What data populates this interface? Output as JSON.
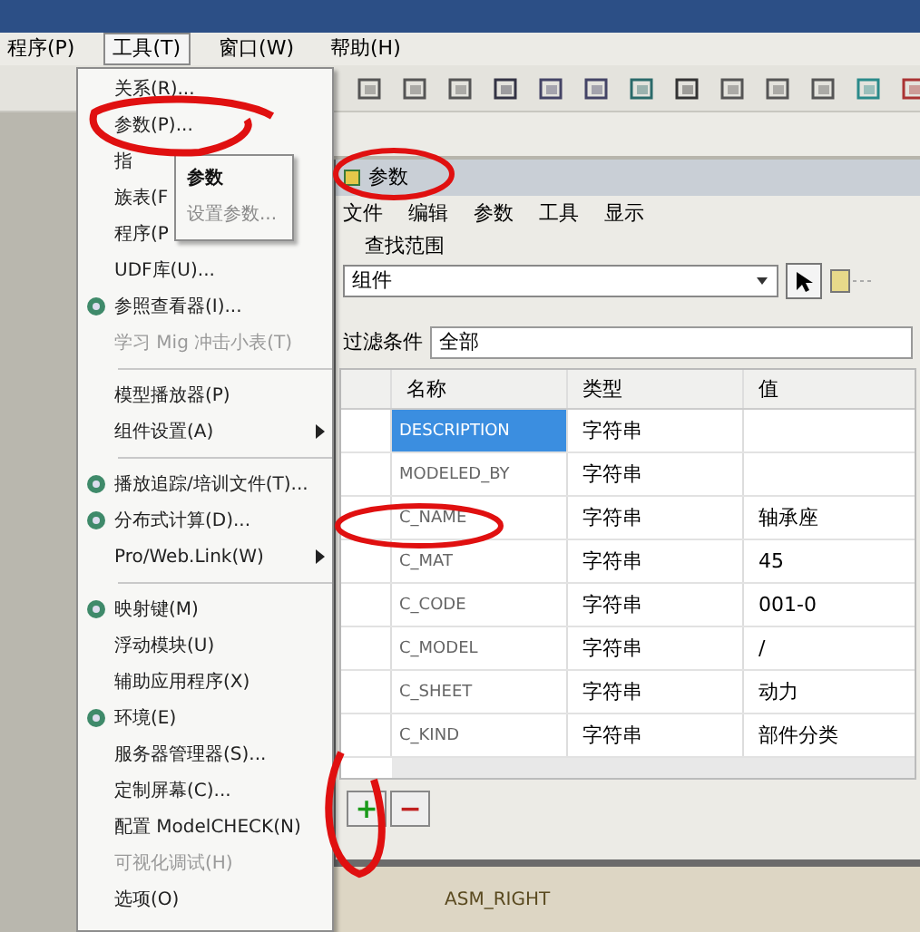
{
  "menubar": [
    {
      "label": "程序(P)",
      "selected": false
    },
    {
      "label": "工具(T)",
      "selected": true
    },
    {
      "label": "窗口(W)",
      "selected": false
    },
    {
      "label": "帮助(H)",
      "selected": false
    }
  ],
  "tools_menu": [
    {
      "kind": "item",
      "label": "关系(R)...",
      "disabled": false,
      "submenu": false
    },
    {
      "kind": "item",
      "label": "参数(P)...",
      "disabled": false,
      "submenu": false
    },
    {
      "kind": "item",
      "label": "指",
      "disabled": false,
      "submenu": false
    },
    {
      "kind": "item",
      "label": "族表(F",
      "disabled": false,
      "submenu": false
    },
    {
      "kind": "item",
      "label": "程序(P",
      "disabled": false,
      "submenu": false
    },
    {
      "kind": "item",
      "label": "UDF库(U)...",
      "disabled": false,
      "submenu": false
    },
    {
      "kind": "icon-item",
      "label": "参照查看器(I)...",
      "disabled": false,
      "submenu": false
    },
    {
      "kind": "item",
      "label": "学习 Mig 冲击小表(T)",
      "disabled": true,
      "submenu": false
    },
    {
      "kind": "separator"
    },
    {
      "kind": "item",
      "label": "模型播放器(P)",
      "disabled": false,
      "submenu": false
    },
    {
      "kind": "item",
      "label": "组件设置(A)",
      "disabled": false,
      "submenu": true
    },
    {
      "kind": "separator"
    },
    {
      "kind": "icon-item",
      "label": "播放追踪/培训文件(T)...",
      "disabled": false,
      "submenu": false
    },
    {
      "kind": "icon-item",
      "label": "分布式计算(D)...",
      "disabled": false,
      "submenu": false
    },
    {
      "kind": "item",
      "label": "Pro/Web.Link(W)",
      "disabled": false,
      "submenu": true
    },
    {
      "kind": "separator"
    },
    {
      "kind": "icon-item",
      "label": "映射键(M)",
      "disabled": false,
      "submenu": false
    },
    {
      "kind": "item",
      "label": "浮动模块(U)",
      "disabled": false,
      "submenu": false
    },
    {
      "kind": "item",
      "label": "辅助应用程序(X)",
      "disabled": false,
      "submenu": false
    },
    {
      "kind": "icon-item",
      "label": "环境(E)",
      "disabled": false,
      "submenu": false
    },
    {
      "kind": "item",
      "label": "服务器管理器(S)...",
      "disabled": false,
      "submenu": false
    },
    {
      "kind": "item",
      "label": "定制屏幕(C)...",
      "disabled": false,
      "submenu": false
    },
    {
      "kind": "item",
      "label": "配置 ModelCHECK(N)",
      "disabled": false,
      "submenu": false
    },
    {
      "kind": "item",
      "label": "可视化调试(H)",
      "disabled": true,
      "submenu": false
    },
    {
      "kind": "item",
      "label": "选项(O)",
      "disabled": false,
      "submenu": false
    }
  ],
  "submenu": [
    {
      "label": "参数",
      "disabled": false
    },
    {
      "label": "设置参数...",
      "disabled": true
    }
  ],
  "dialog": {
    "title": "参数",
    "menus": [
      "文件",
      "编辑",
      "参数",
      "工具",
      "显示"
    ],
    "lookin_label": "查找范围",
    "lookin_value": "组件",
    "filter_label": "过滤条件",
    "filter_value": "全部",
    "columns": [
      "名称",
      "类型",
      "值"
    ],
    "rows": [
      {
        "name": "DESCRIPTION",
        "type": "字符串",
        "value": "",
        "selected": true
      },
      {
        "name": "MODELED_BY",
        "type": "字符串",
        "value": "",
        "selected": false
      },
      {
        "name": "C_NAME",
        "type": "字符串",
        "value": "轴承座",
        "selected": false
      },
      {
        "name": "C_MAT",
        "type": "字符串",
        "value": "45",
        "selected": false
      },
      {
        "name": "C_CODE",
        "type": "字符串",
        "value": "001-0",
        "selected": false
      },
      {
        "name": "C_MODEL",
        "type": "字符串",
        "value": "/",
        "selected": false
      },
      {
        "name": "C_SHEET",
        "type": "字符串",
        "value": "动力",
        "selected": false
      },
      {
        "name": "C_KIND",
        "type": "字符串",
        "value": "部件分类",
        "selected": false
      }
    ],
    "add_button": "+",
    "remove_button": "−"
  },
  "model_label": "ASM_RIGHT"
}
